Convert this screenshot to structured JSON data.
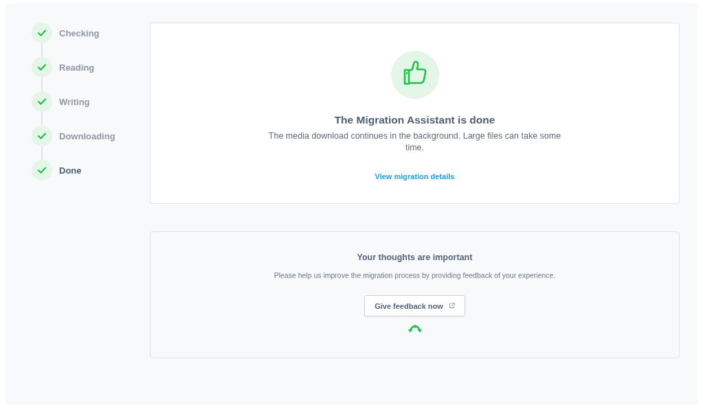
{
  "steps": [
    {
      "label": "Checking",
      "completed": true,
      "selected": false
    },
    {
      "label": "Reading",
      "completed": true,
      "selected": false
    },
    {
      "label": "Writing",
      "completed": true,
      "selected": false
    },
    {
      "label": "Downloading",
      "completed": true,
      "selected": false
    },
    {
      "label": "Done",
      "completed": true,
      "selected": true
    }
  ],
  "result_card": {
    "title": "The Migration Assistant is done",
    "message": "The media download continues in the background. Large files can take some time.",
    "link": "View migration details"
  },
  "feedback_card": {
    "title": "Your thoughts are important",
    "message": "Please help us improve the migration process by providing feedback of your experience.",
    "button": "Give feedback now"
  }
}
